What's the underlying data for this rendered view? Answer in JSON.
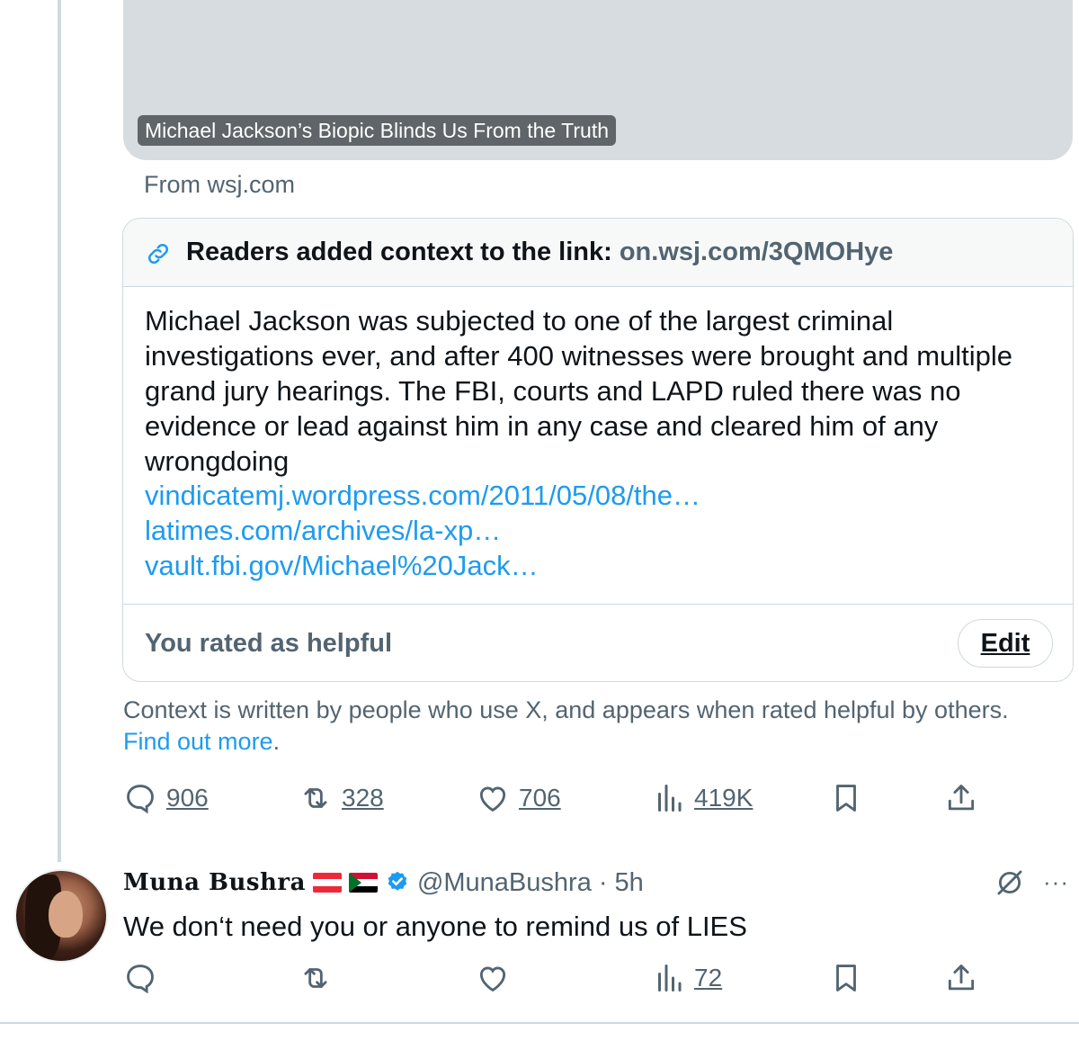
{
  "link_card": {
    "title": "Michael Jackson’s Biopic Blinds Us From the Truth",
    "source": "From wsj.com"
  },
  "community_note": {
    "header_label": "Readers added context to the link: ",
    "header_link": "on.wsj.com/3QMOHye",
    "body": "Michael Jackson was subjected to one of the largest criminal investigations ever, and after 400 witnesses were brought and multiple grand jury hearings. The FBI, courts and LAPD ruled there was no evidence or lead against him in any case and cleared him of any wrongdoing",
    "links": [
      "vindicatemj.wordpress.com/2011/05/08/the…",
      "latimes.com/archives/la-xp…",
      "vault.fbi.gov/Michael%20Jack…"
    ],
    "rating_status": "You rated as helpful",
    "edit_label": "Edit"
  },
  "disclaimer": {
    "text": "Context is written by people who use X, and appears when rated helpful by others. ",
    "link": "Find out more",
    "suffix": "."
  },
  "main_actions": {
    "replies": "906",
    "reposts": "328",
    "likes": "706",
    "views": "419K"
  },
  "reply": {
    "display_name": "Muna Bushra",
    "handle": "@MunaBushra",
    "separator": "·",
    "time": "5h",
    "text": "We don‘t need you or anyone to remind us of LIES",
    "views": "72",
    "more": "···"
  },
  "colors": {
    "accent": "#1d9bf0",
    "secondary_text": "#536471",
    "border": "#cfd9de"
  },
  "icons": [
    "link-icon",
    "reply-icon",
    "repost-icon",
    "like-icon",
    "views-icon",
    "bookmark-icon",
    "share-icon",
    "verified-badge-icon",
    "grok-icon",
    "more-icon"
  ]
}
